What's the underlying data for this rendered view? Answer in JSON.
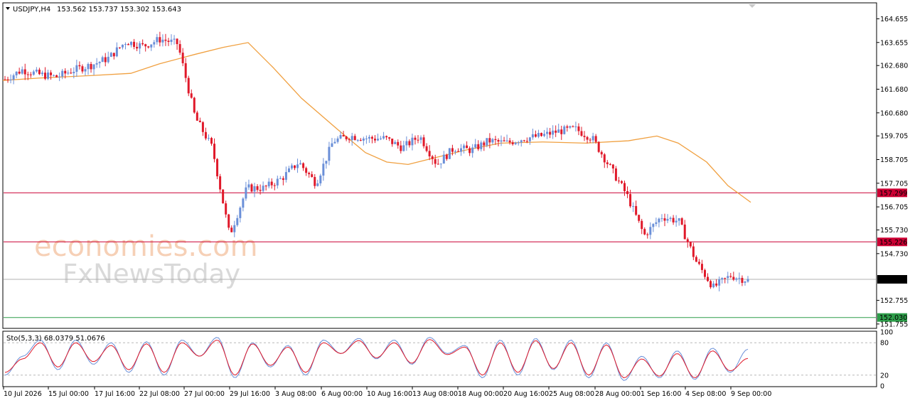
{
  "header": {
    "symbol": "USDJPY,H4",
    "ohlc": "153.562 153.737 153.302 153.643"
  },
  "watermark": {
    "line1": "economies.com",
    "line2": "FxNewsToday"
  },
  "stoch": {
    "label": "Sto(5,3,3) 68.0379 51.0676",
    "levels": [
      80,
      20
    ],
    "axis_labels": [
      "100",
      "80",
      "20",
      "0"
    ]
  },
  "chart_data": {
    "type": "candlestick",
    "symbol": "USDJPY",
    "timeframe": "H4",
    "y_ticks": [
      "164.655",
      "163.655",
      "162.680",
      "161.680",
      "160.680",
      "159.705",
      "158.705",
      "157.705",
      "156.705",
      "155.730",
      "154.730",
      "152.755",
      "151.755"
    ],
    "ylim": [
      151.6,
      165.3
    ],
    "x_ticks": [
      "10 Jul 2026",
      "15 Jul 00:00",
      "17 Jul 16:00",
      "22 Jul 08:00",
      "27 Jul 00:00",
      "29 Jul 16:00",
      "3 Aug 08:00",
      "6 Aug 00:00",
      "10 Aug 16:00",
      "13 Aug 08:00",
      "18 Aug 00:00",
      "20 Aug 16:00",
      "25 Aug 08:00",
      "28 Aug 00:00",
      "1 Sep 16:00",
      "4 Sep 08:00",
      "9 Sep 00:00"
    ],
    "horizontal_lines": [
      {
        "value": 157.299,
        "label": "157.299",
        "color": "#cc0033"
      },
      {
        "value": 155.226,
        "label": "155.226",
        "color": "#cc0033"
      },
      {
        "value": 152.03,
        "label": "152.030",
        "color": "#2e9e4a"
      },
      {
        "value": 153.643,
        "label": "153.643",
        "color": "#b0b0b0"
      }
    ],
    "price_path": [
      162.1,
      162.5,
      162.3,
      162.2,
      162.5,
      162.7,
      163.0,
      163.7,
      163.5,
      163.8,
      163.6,
      160.5,
      159.2,
      155.5,
      157.5,
      157.5,
      157.9,
      158.6,
      157.7,
      159.5,
      159.7,
      159.6,
      159.6,
      159.2,
      159.7,
      158.5,
      159.2,
      159.1,
      159.5,
      159.4,
      159.6,
      159.7,
      159.9,
      160.0,
      159.6,
      158.4,
      157.2,
      155.5,
      156.3,
      156.1,
      154.4,
      153.3,
      153.8,
      153.6
    ],
    "ma": [
      [
        0,
        162.05
      ],
      [
        50,
        162.15
      ],
      [
        120,
        162.25
      ],
      [
        180,
        162.35
      ],
      [
        220,
        162.75
      ],
      [
        270,
        163.15
      ],
      [
        310,
        163.45
      ],
      [
        345,
        163.65
      ],
      [
        380,
        162.6
      ],
      [
        420,
        161.3
      ],
      [
        470,
        160.0
      ],
      [
        510,
        159.0
      ],
      [
        540,
        158.6
      ],
      [
        570,
        158.5
      ],
      [
        610,
        158.8
      ],
      [
        650,
        159.1
      ],
      [
        700,
        159.4
      ],
      [
        760,
        159.45
      ],
      [
        820,
        159.4
      ],
      [
        880,
        159.5
      ],
      [
        920,
        159.7
      ],
      [
        950,
        159.4
      ],
      [
        990,
        158.6
      ],
      [
        1020,
        157.6
      ],
      [
        1052,
        156.9
      ]
    ],
    "stoch_k_path": [
      20,
      55,
      85,
      30,
      85,
      40,
      80,
      25,
      82,
      20,
      85,
      55,
      90,
      15,
      80,
      35,
      75,
      20,
      85,
      60,
      88,
      50,
      85,
      40,
      90,
      60,
      75,
      15,
      85,
      20,
      88,
      30,
      85,
      15,
      80,
      10,
      55,
      15,
      65,
      12,
      70,
      25,
      68
    ],
    "stoch_d_path": [
      25,
      50,
      80,
      35,
      80,
      45,
      75,
      30,
      78,
      25,
      80,
      55,
      85,
      20,
      78,
      38,
      72,
      25,
      80,
      60,
      84,
      52,
      80,
      42,
      86,
      58,
      72,
      20,
      80,
      25,
      84,
      32,
      80,
      20,
      76,
      15,
      50,
      18,
      60,
      15,
      65,
      28,
      51
    ]
  }
}
